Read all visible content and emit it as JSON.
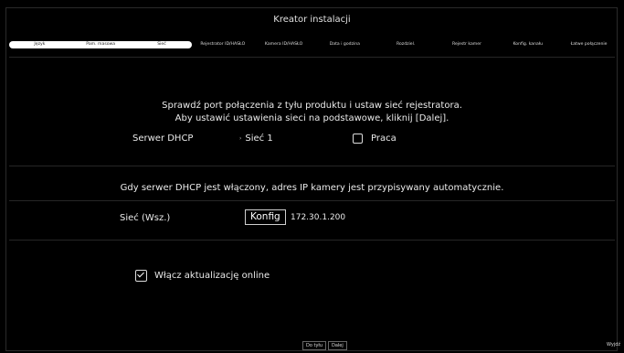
{
  "window": {
    "title": "Kreator instalacji"
  },
  "steps": [
    {
      "label": "Język",
      "state": "done"
    },
    {
      "label": "Pam. masowa",
      "state": "done"
    },
    {
      "label": "Sieć",
      "state": "current"
    },
    {
      "label": "Rejestrator ID/HASŁO",
      "state": "todo"
    },
    {
      "label": "Kamera ID/HASŁO",
      "state": "todo"
    },
    {
      "label": "Data i godzina",
      "state": "todo"
    },
    {
      "label": "Rozdziel.",
      "state": "todo"
    },
    {
      "label": "Rejestr kamer",
      "state": "todo"
    },
    {
      "label": "Konfig. kanału",
      "state": "todo"
    },
    {
      "label": "Łatwe połączenie",
      "state": "todo"
    }
  ],
  "intro": {
    "line1": "Sprawdź port połączenia z tyłu produktu i ustaw sieć rejestratora.",
    "line2": "Aby ustawić ustawienia sieci na podstawowe, kliknij [Dalej]."
  },
  "dhcp": {
    "label": "Serwer DHCP",
    "network_value": "Sieć 1",
    "work_label": "Praca",
    "work_checked": false
  },
  "info_text": "Gdy serwer DHCP jest włączony, adres IP kamery jest przypisywany automatycznie.",
  "network": {
    "label": "Sieć (Wsz.)",
    "config_button": "Konfig",
    "ip": "172.30.1.200"
  },
  "online_update": {
    "label": "Włącz aktualizację online",
    "checked": true
  },
  "footer": {
    "back_label": "Do tyłu",
    "next_label": "Dalej",
    "exit_label": "Wyjdź"
  }
}
